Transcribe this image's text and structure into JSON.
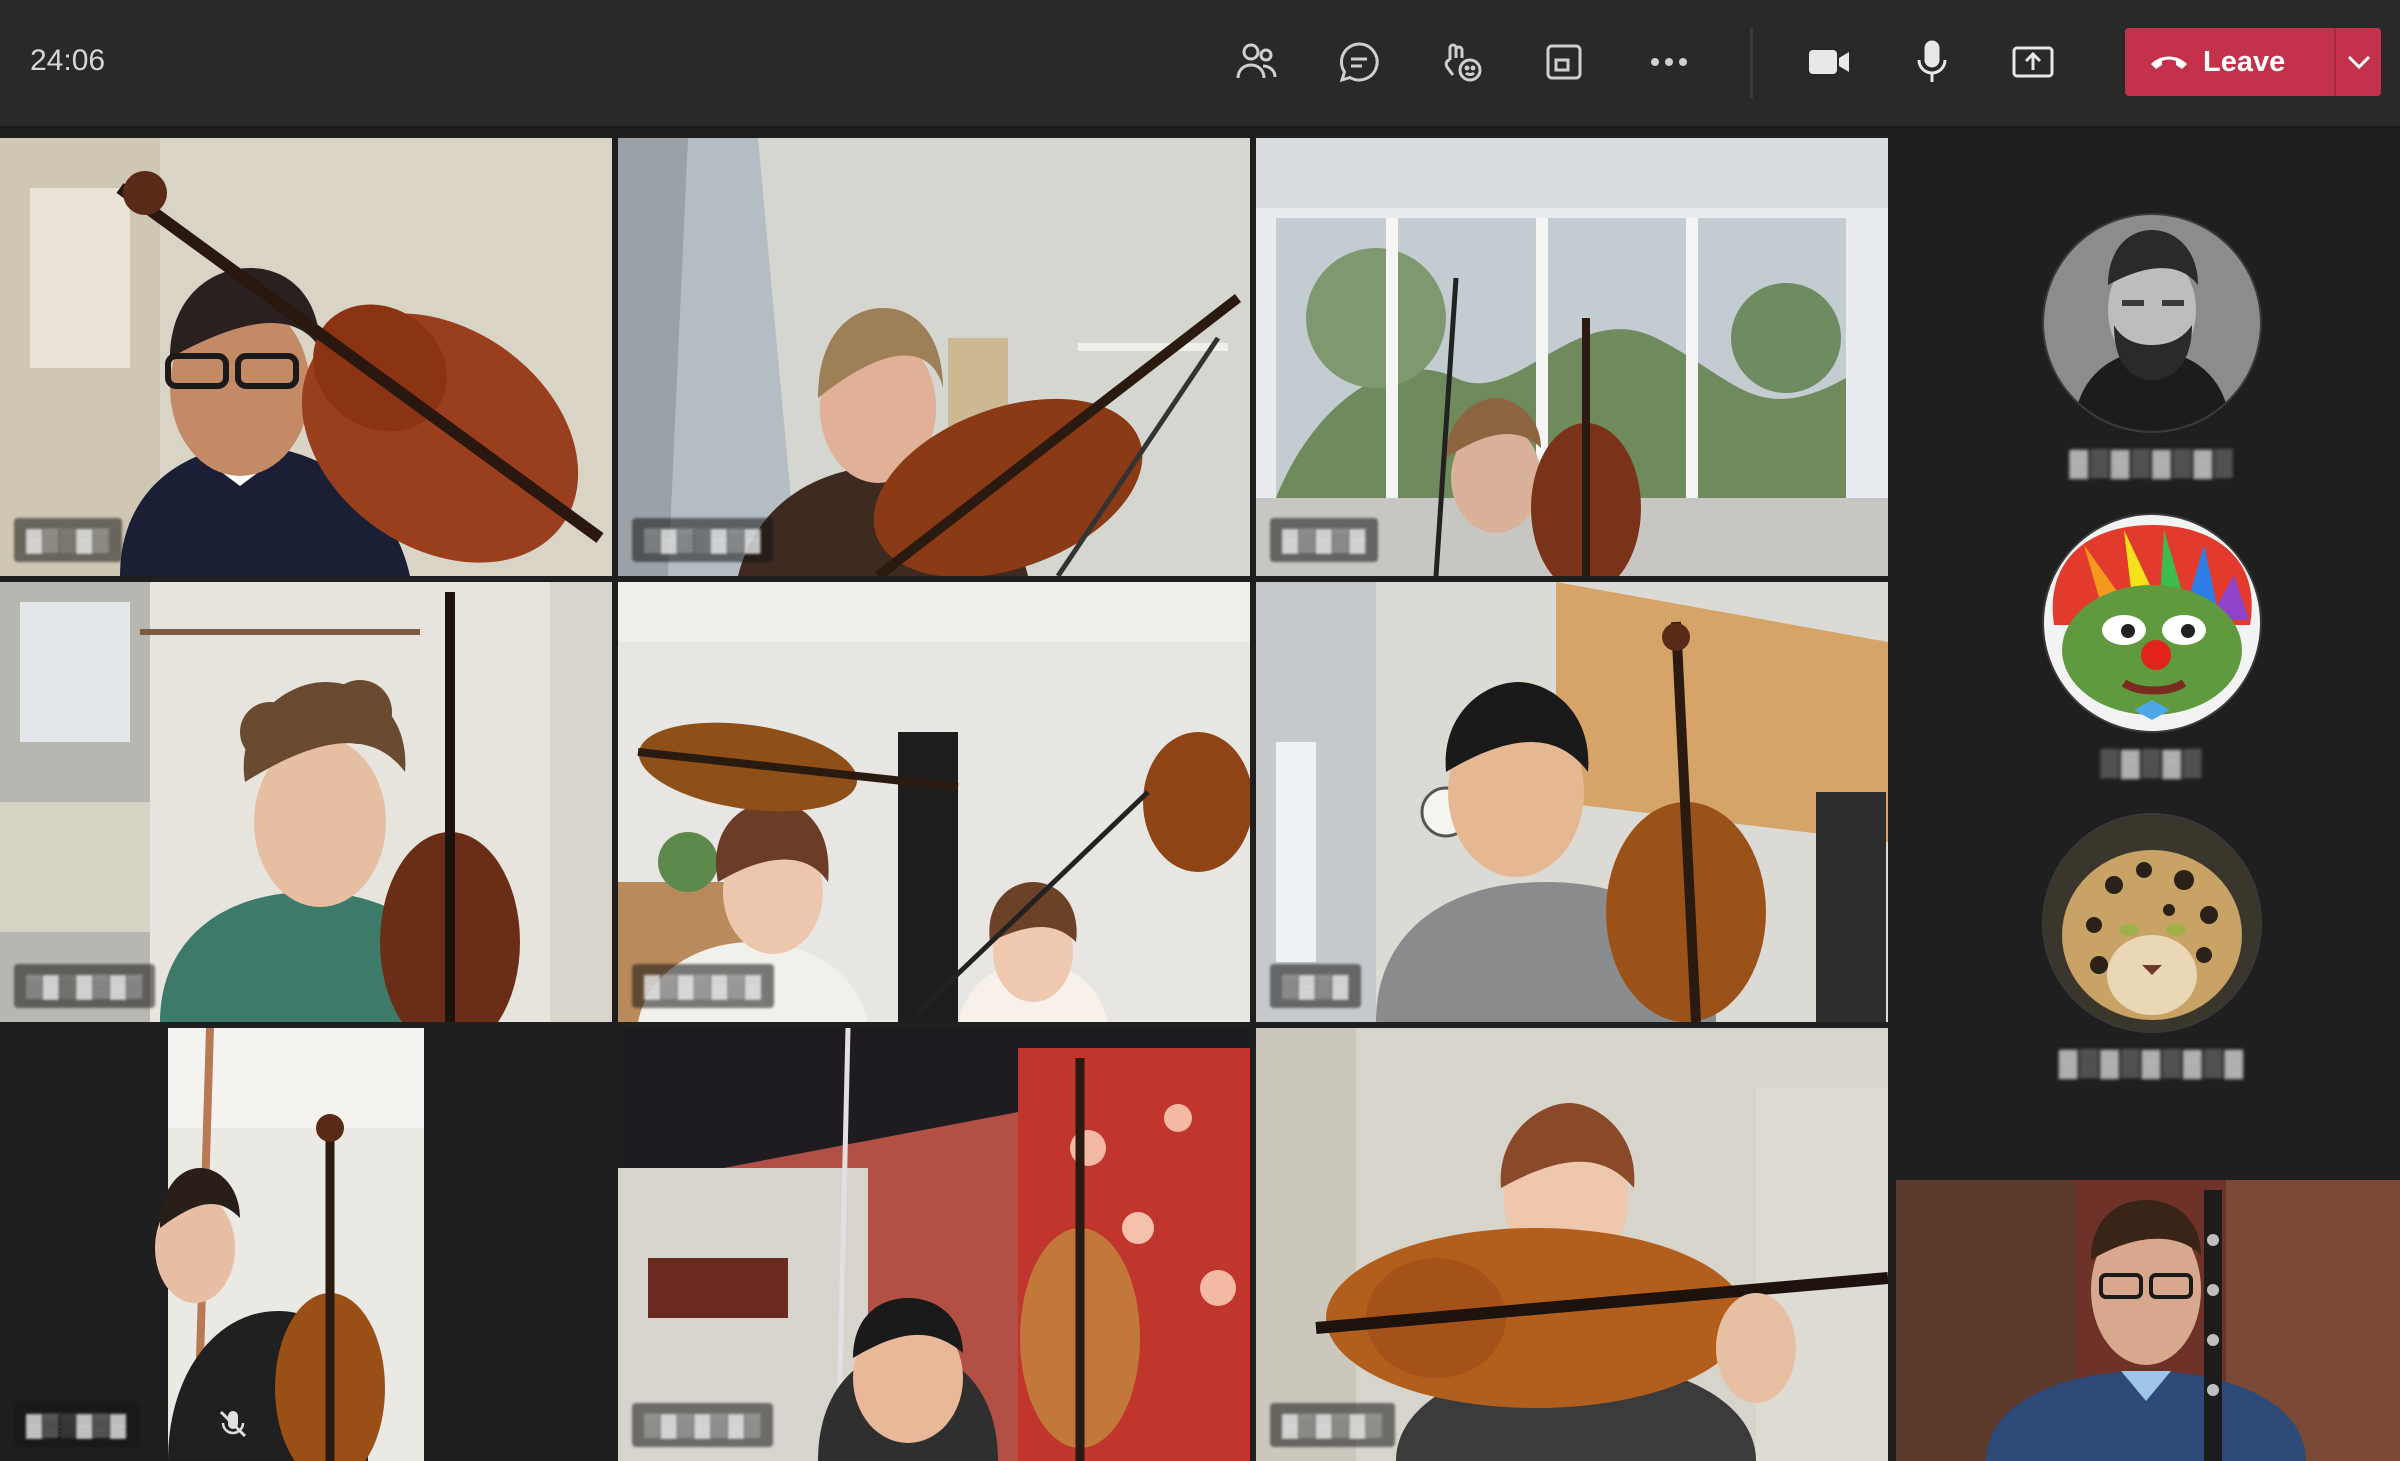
{
  "toolbar": {
    "timer": "24:06",
    "leave_label": "Leave",
    "icons": [
      "people-icon",
      "chat-icon",
      "reactions-icon",
      "rooms-icon",
      "more-icon",
      "camera-icon",
      "mic-icon",
      "share-icon"
    ]
  },
  "colors": {
    "leave_bg": "#c4314b",
    "bar_bg": "#292929",
    "stage_bg": "#1f1f1f"
  },
  "tiles": [
    {
      "name": "▓▒░▓▒"
    },
    {
      "name": "▒▓▒░▓▒▓"
    },
    {
      "name": "▓▒▓▒▓"
    },
    {
      "name": "▒▓░▓▒▓▒"
    },
    {
      "name": "▓▒▓▒▓▒▓"
    },
    {
      "name": "▒▓▒▓"
    },
    {
      "name": "▓▒░▓▒▓"
    },
    {
      "name": "▒▓▒▓▒▓▒"
    },
    {
      "name": "▓▒▓▒▓▒"
    },
    {
      "name": ""
    }
  ],
  "roster": [
    {
      "name": "▓▒▓▒▓▒▓▒"
    },
    {
      "name": "▒▓▒▓▒"
    },
    {
      "name": "▓▒▓▒▓▒▓▒▓"
    }
  ]
}
